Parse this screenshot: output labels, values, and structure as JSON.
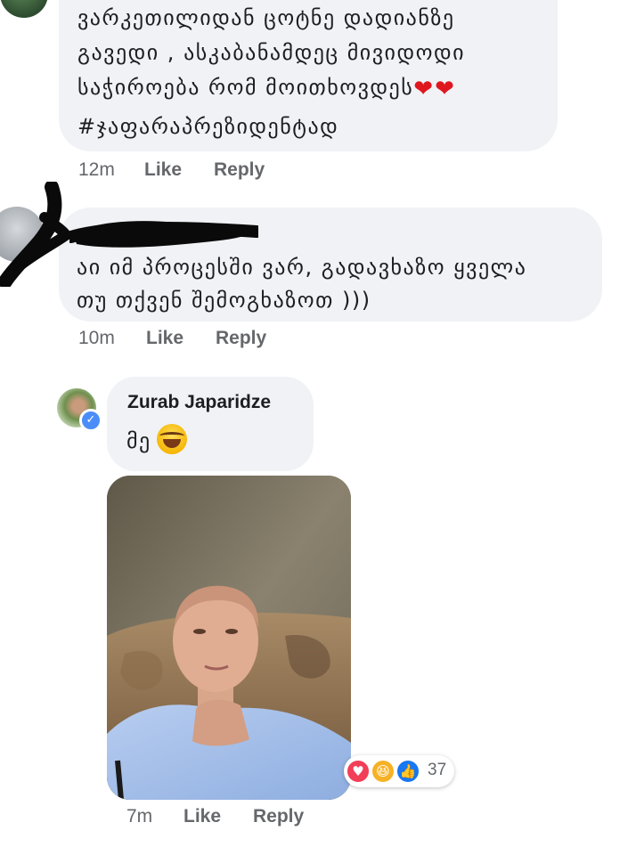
{
  "comments": [
    {
      "lines": [
        "ვარკეთილიდან ცოტნე დადიანზე",
        "გავედი , ასკაბანამდეც მივიდოდი",
        "საჭიროება რომ მოითხოვდეს"
      ],
      "hashtag": "#ჯაფარაპრეზიდენტად",
      "time": "12m",
      "like_label": "Like",
      "reply_label": "Reply"
    },
    {
      "lines": [
        "აი იმ პროცესში ვარ, გადავხაზო ყველა",
        "თუ თქვენ შემოგხაზოთ )))"
      ],
      "time": "10m",
      "like_label": "Like",
      "reply_label": "Reply"
    }
  ],
  "reply": {
    "author": "Zurab Japaridze",
    "text": "მე",
    "emoji": "face-with-tears-of-joy",
    "time": "7m",
    "like_label": "Like",
    "reply_label": "Reply",
    "reaction_count": "37",
    "reactions": [
      "love",
      "haha",
      "like"
    ]
  },
  "colors": {
    "bubble": "#f0f2f5",
    "meta_text": "#65676b",
    "verified": "#4b8df8",
    "love": "#f33e58",
    "haha": "#f7b125",
    "like": "#1877f2"
  }
}
